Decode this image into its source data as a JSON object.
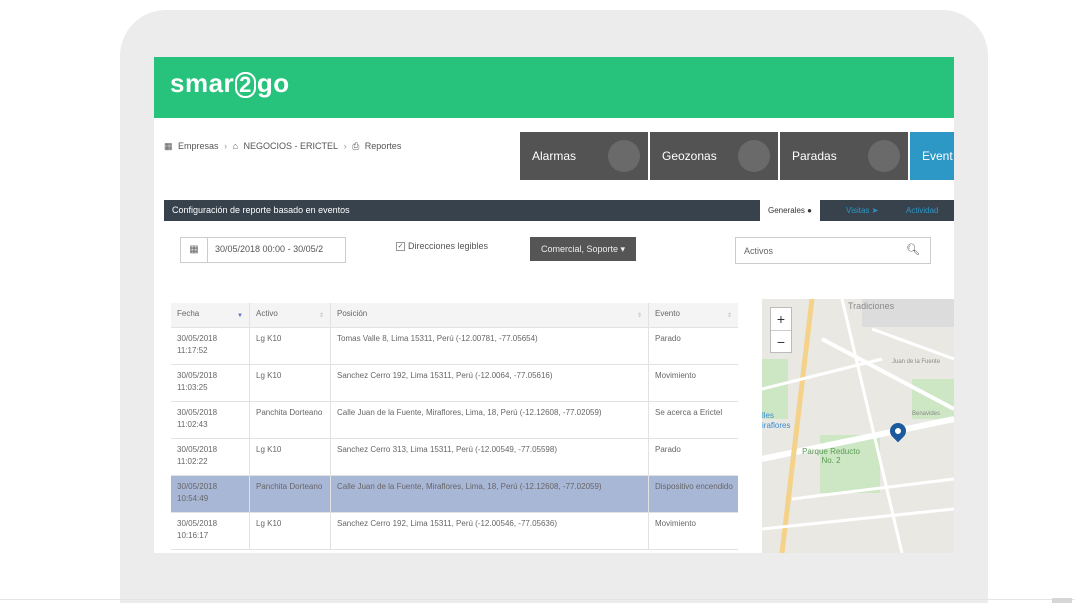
{
  "brand": {
    "logo_pre": "smar",
    "logo_two": "2",
    "logo_post": "go"
  },
  "breadcrumb": {
    "items": [
      "Empresas",
      "NEGOCIOS - ERICTEL",
      "Reportes"
    ],
    "sep": "›"
  },
  "tiles": [
    "Alarmas",
    "Geozonas",
    "Paradas",
    "Event"
  ],
  "config": {
    "title": "Configuración de reporte basado en eventos",
    "tabs": [
      "Generales",
      "Visitas",
      "Actividad"
    ]
  },
  "filters": {
    "date_range": "30/05/2018 00:00 - 30/05/2",
    "checkbox_label": "Direcciones legibles",
    "dropdown": "Comercial, Soporte",
    "search_placeholder": "Activos"
  },
  "table": {
    "headers": [
      "Fecha",
      "Activo",
      "Posición",
      "Evento"
    ],
    "rows": [
      {
        "fecha": "30/05/2018 11:17:52",
        "activo": "Lg K10",
        "posicion": "Tomas Valle 8, Lima 15311, Perú (-12.00781, -77.05654)",
        "evento": "Parado"
      },
      {
        "fecha": "30/05/2018 11:03:25",
        "activo": "Lg K10",
        "posicion": "Sanchez Cerro 192, Lima 15311, Perú (-12.0064, -77.05616)",
        "evento": "Movimiento"
      },
      {
        "fecha": "30/05/2018 11:02:43",
        "activo": "Panchita Dorteano",
        "posicion": "Calle Juan de la Fuente, Miraflores, Lima, 18, Perú (-12.12608, -77.02059)",
        "evento": "Se acerca a Erictel"
      },
      {
        "fecha": "30/05/2018 11:02:22",
        "activo": "Lg K10",
        "posicion": "Sanchez Cerro 313, Lima 15311, Perú (-12.00549, -77.05598)",
        "evento": "Parado"
      },
      {
        "fecha": "30/05/2018 10:54:49",
        "activo": "Panchita Dorteano",
        "posicion": "Calle Juan de la Fuente, Miraflores, Lima, 18, Perú (-12.12608, -77.02059)",
        "evento": "Dispositivo encendido"
      },
      {
        "fecha": "30/05/2018 10:16:17",
        "activo": "Lg K10",
        "posicion": "Sanchez Cerro 192, Lima 15311, Perú (-12.00546, -77.05636)",
        "evento": "Movimiento"
      }
    ]
  },
  "map": {
    "labels": [
      "Tradiciones",
      "Parque Reducto No. 2",
      "lles",
      "iraflores",
      "Benavides",
      "Juan de la Fuente"
    ],
    "zoom_in": "+",
    "zoom_out": "−"
  },
  "colors": {
    "brand_green": "#27c37c",
    "tile_gray": "#535353",
    "tile_active": "#2d97c5",
    "bar_dark": "#37424d",
    "highlight_row": "#a9b7d6"
  }
}
